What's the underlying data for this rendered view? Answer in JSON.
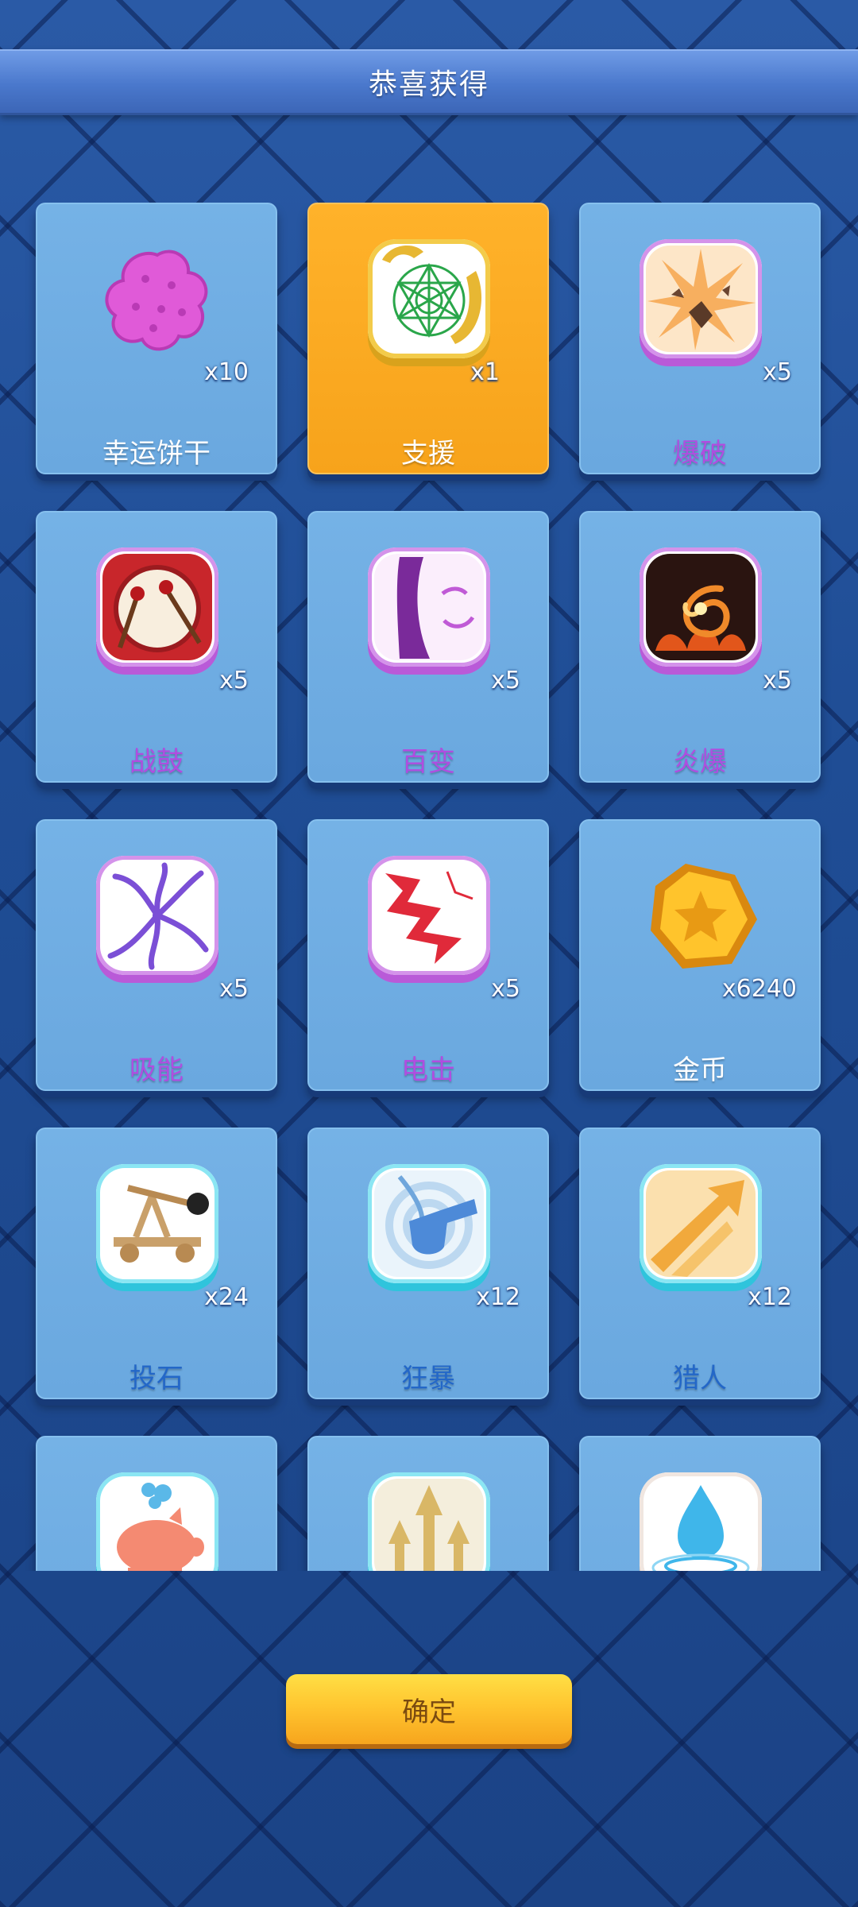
{
  "header": {
    "title": "恭喜获得"
  },
  "colors": {
    "name_purple": "#b04de0",
    "name_blue": "#2367c8",
    "name_white": "#ffffff",
    "selected_card": "#f7a31b"
  },
  "rewards": [
    {
      "name": "幸运饼干",
      "count": "x10",
      "icon": "lucky-cookie-icon"
    },
    {
      "name": "支援",
      "count": "x1",
      "icon": "support-icon",
      "selected": true
    },
    {
      "name": "爆破",
      "count": "x5",
      "icon": "blast-icon"
    },
    {
      "name": "战鼓",
      "count": "x5",
      "icon": "war-drum-icon"
    },
    {
      "name": "百变",
      "count": "x5",
      "icon": "mask-icon"
    },
    {
      "name": "炎爆",
      "count": "x5",
      "icon": "fire-blast-icon"
    },
    {
      "name": "吸能",
      "count": "x5",
      "icon": "absorb-icon"
    },
    {
      "name": "电击",
      "count": "x5",
      "icon": "lightning-icon"
    },
    {
      "name": "金币",
      "count": "x6240",
      "icon": "gold-coin-icon"
    },
    {
      "name": "投石",
      "count": "x24",
      "icon": "catapult-icon"
    },
    {
      "name": "狂暴",
      "count": "x12",
      "icon": "berserk-icon"
    },
    {
      "name": "猎人",
      "count": "x12",
      "icon": "hunter-icon"
    },
    {
      "name": "",
      "count": "",
      "icon": "piggy-bank-icon"
    },
    {
      "name": "",
      "count": "",
      "icon": "arrows-up-icon"
    },
    {
      "name": "",
      "count": "",
      "icon": "water-drop-icon"
    }
  ],
  "confirm": {
    "label": "确定"
  }
}
